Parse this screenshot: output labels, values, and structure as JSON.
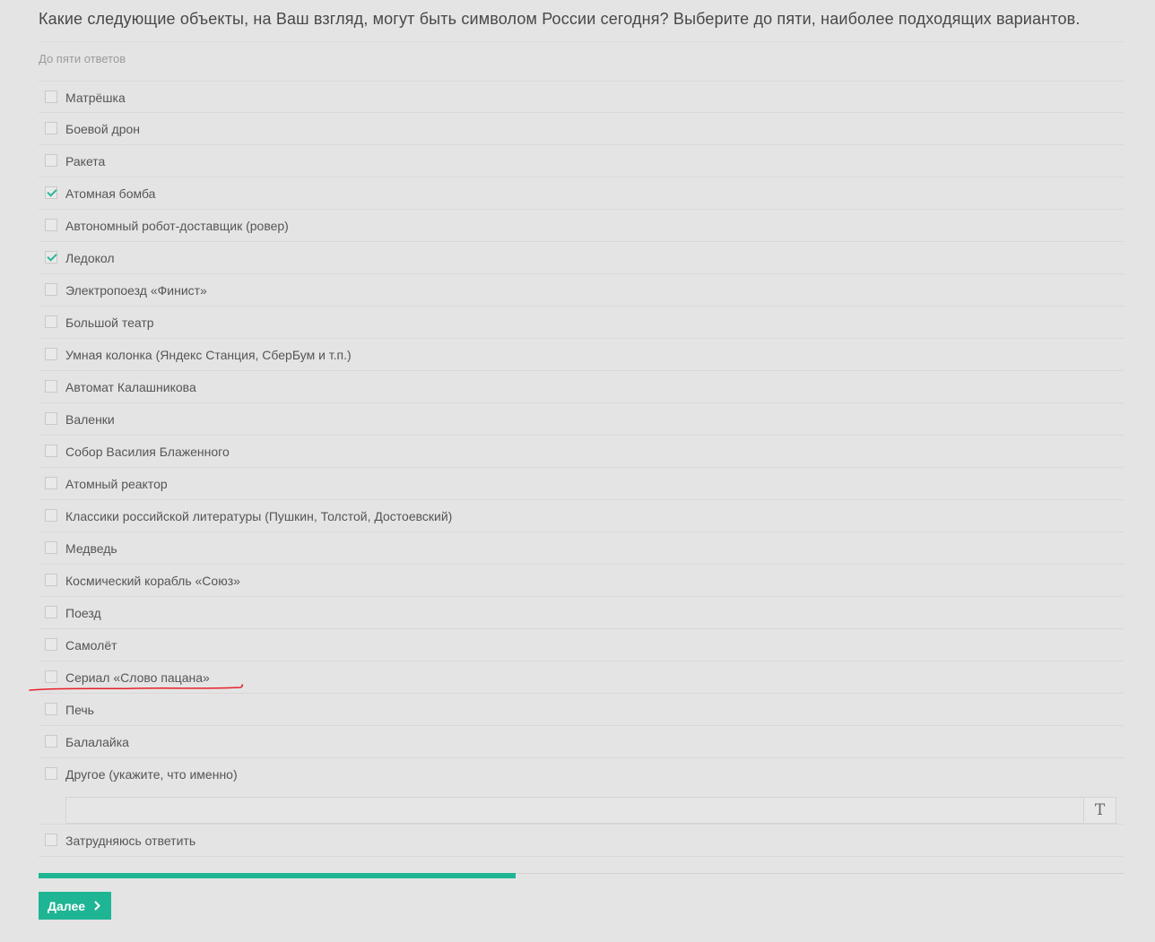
{
  "question": {
    "text": "Какие следующие объекты, на Ваш взгляд, могут быть символом России сегодня? Выберите до пяти, наиболее подходящих вариантов.",
    "hint": "До пяти ответов"
  },
  "options": [
    {
      "label": "Матрёшка",
      "checked": false
    },
    {
      "label": "Боевой дрон",
      "checked": false
    },
    {
      "label": "Ракета",
      "checked": false
    },
    {
      "label": "Атомная бомба",
      "checked": true
    },
    {
      "label": "Автономный робот-доставщик (ровер)",
      "checked": false
    },
    {
      "label": "Ледокол",
      "checked": true
    },
    {
      "label": "Электропоезд «Финист»",
      "checked": false
    },
    {
      "label": "Большой театр",
      "checked": false
    },
    {
      "label": "Умная колонка (Яндекс Станция, СберБум и т.п.)",
      "checked": false
    },
    {
      "label": "Автомат Калашникова",
      "checked": false
    },
    {
      "label": "Валенки",
      "checked": false
    },
    {
      "label": "Собор Василия Блаженного",
      "checked": false
    },
    {
      "label": "Атомный реактор",
      "checked": false
    },
    {
      "label": "Классики российской литературы (Пушкин, Толстой, Достоевский)",
      "checked": false
    },
    {
      "label": "Медведь",
      "checked": false
    },
    {
      "label": "Космический корабль «Союз»",
      "checked": false
    },
    {
      "label": "Поезд",
      "checked": false
    },
    {
      "label": "Самолёт",
      "checked": false
    },
    {
      "label": "Сериал «Слово пацана»",
      "checked": false
    },
    {
      "label": "Печь",
      "checked": false
    },
    {
      "label": "Балалайка",
      "checked": false
    },
    {
      "label": "Другое (укажите, что именно)",
      "checked": false
    },
    {
      "label": "Затрудняюсь ответить",
      "checked": false
    }
  ],
  "other_input": {
    "value": "",
    "placeholder": "",
    "text_icon": "T"
  },
  "progress": {
    "fraction": 0.44
  },
  "next_button": {
    "label": "Далее",
    "icon": "chevron-right-icon"
  },
  "colors": {
    "accent": "#1eb594",
    "check": "#2bb598",
    "annotation": "#e8202a",
    "background": "#e4e4e4"
  }
}
